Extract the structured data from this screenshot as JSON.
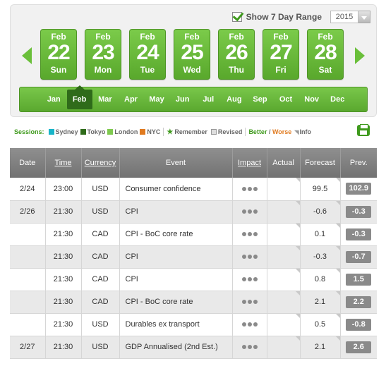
{
  "range": {
    "label": "Show 7 Day Range",
    "checked": true,
    "year": "2015"
  },
  "days": [
    {
      "month": "Feb",
      "day": "22",
      "weekday": "Sun"
    },
    {
      "month": "Feb",
      "day": "23",
      "weekday": "Mon"
    },
    {
      "month": "Feb",
      "day": "24",
      "weekday": "Tue"
    },
    {
      "month": "Feb",
      "day": "25",
      "weekday": "Wed"
    },
    {
      "month": "Feb",
      "day": "26",
      "weekday": "Thu"
    },
    {
      "month": "Feb",
      "day": "27",
      "weekday": "Fri"
    },
    {
      "month": "Feb",
      "day": "28",
      "weekday": "Sat"
    }
  ],
  "months": [
    "Jan",
    "Feb",
    "Mar",
    "Apr",
    "May",
    "Jun",
    "Jul",
    "Aug",
    "Sep",
    "Oct",
    "Nov",
    "Dec"
  ],
  "active_month": "Feb",
  "legend": {
    "sessions_label": "Sessions:",
    "sessions": [
      {
        "name": "Sydney",
        "color": "#17b4c8"
      },
      {
        "name": "Tokyo",
        "color": "#2f6b1a"
      },
      {
        "name": "London",
        "color": "#7fc94f"
      },
      {
        "name": "NYC",
        "color": "#e07a1f"
      }
    ],
    "remember": "Remember",
    "revised": "Revised",
    "better": "Better",
    "slash": " / ",
    "worse": "Worse",
    "info": "Info"
  },
  "table": {
    "headers": {
      "date": "Date",
      "time": "Time",
      "currency": "Currency",
      "event": "Event",
      "impact": "Impact",
      "actual": "Actual",
      "forecast": "Forecast",
      "prev": "Prev."
    },
    "rows": [
      {
        "date": "2/24",
        "time": "23:00",
        "currency": "USD",
        "event": "Consumer confidence",
        "actual": "",
        "forecast": "99.5",
        "prev": "102.9"
      },
      {
        "date": "2/26",
        "time": "21:30",
        "currency": "USD",
        "event": "CPI",
        "actual": "",
        "forecast": "-0.6",
        "prev": "-0.3"
      },
      {
        "date": "",
        "time": "21:30",
        "currency": "CAD",
        "event": "CPI - BoC core rate",
        "actual": "",
        "forecast": "0.1",
        "prev": "-0.3"
      },
      {
        "date": "",
        "time": "21:30",
        "currency": "CAD",
        "event": "CPI",
        "actual": "",
        "forecast": "-0.3",
        "prev": "-0.7"
      },
      {
        "date": "",
        "time": "21:30",
        "currency": "CAD",
        "event": "CPI",
        "actual": "",
        "forecast": "0.8",
        "prev": "1.5"
      },
      {
        "date": "",
        "time": "21:30",
        "currency": "CAD",
        "event": "CPI - BoC core rate",
        "actual": "",
        "forecast": "2.1",
        "prev": "2.2"
      },
      {
        "date": "",
        "time": "21:30",
        "currency": "USD",
        "event": "Durables ex transport",
        "actual": "",
        "forecast": "0.5",
        "prev": "-0.8"
      },
      {
        "date": "2/27",
        "time": "21:30",
        "currency": "USD",
        "event": "GDP Annualised (2nd Est.)",
        "actual": "",
        "forecast": "2.1",
        "prev": "2.6"
      }
    ]
  }
}
